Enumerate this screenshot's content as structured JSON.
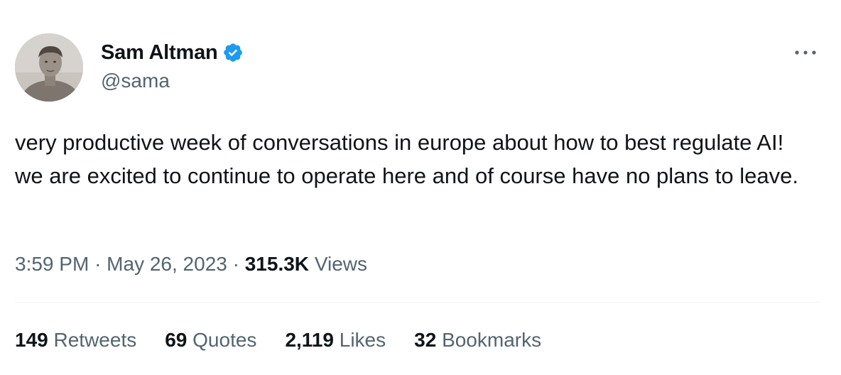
{
  "author": {
    "display_name": "Sam Altman",
    "handle": "@sama",
    "verified": true,
    "avatar_icon": "profile-photo"
  },
  "more_icon": "more-horizontal-icon",
  "tweet": {
    "text": "very productive week of conversations in europe about how to best regulate AI! we are excited to continue to operate here and of course have no plans to leave.",
    "time": "3:59 PM",
    "date": "May 26, 2023",
    "separator": "·",
    "views_count": "315.3K",
    "views_label": "Views"
  },
  "stats": {
    "retweets": {
      "count": "149",
      "label": "Retweets"
    },
    "quotes": {
      "count": "69",
      "label": "Quotes"
    },
    "likes": {
      "count": "2,119",
      "label": "Likes"
    },
    "bookmarks": {
      "count": "32",
      "label": "Bookmarks"
    }
  },
  "colors": {
    "verified_badge": "#1d9bf0",
    "primary_text": "#0f1419",
    "secondary_text": "#536471",
    "divider": "#eff3f4"
  }
}
